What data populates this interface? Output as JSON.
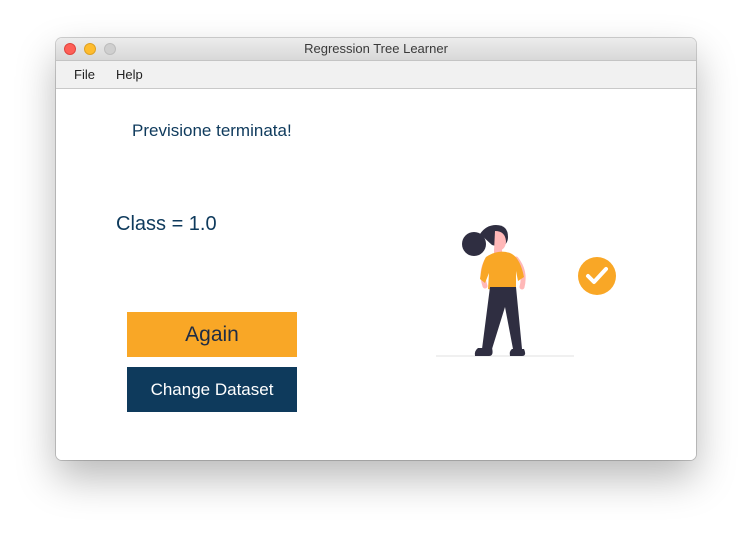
{
  "window": {
    "title": "Regression Tree Learner"
  },
  "menubar": {
    "items": [
      {
        "label": "File"
      },
      {
        "label": "Help"
      }
    ]
  },
  "main": {
    "status_text": "Previsione terminata!",
    "result_text": "Class = 1.0",
    "again_label": "Again",
    "change_dataset_label": "Change Dataset"
  },
  "colors": {
    "accent": "#f9a726",
    "primary": "#0e3a5c"
  },
  "icons": {
    "illustration": "woman-checkmark-illustration",
    "check": "check-circle-icon"
  }
}
